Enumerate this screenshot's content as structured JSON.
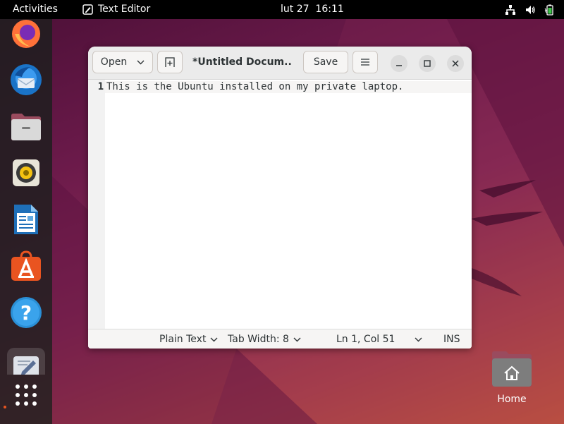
{
  "topbar": {
    "activities_label": "Activities",
    "app_menu_label": "Text Editor",
    "clock": "lut 27  16:11",
    "tray_icons": [
      "network-icon",
      "volume-icon",
      "battery-icon"
    ]
  },
  "dock": {
    "apps": [
      "firefox",
      "thunderbird",
      "files",
      "rhythmbox",
      "libreoffice-writer",
      "app-center",
      "help",
      "text-editor"
    ],
    "show_apps": "show-apps-grid-icon"
  },
  "window": {
    "open_label": "Open",
    "title": "*Untitled Docum...",
    "save_label": "Save",
    "lines": [
      {
        "number": "1",
        "text": "This is the Ubuntu installed on my private laptop."
      }
    ],
    "statusbar": {
      "language": "Plain Text",
      "tab_width": "Tab Width: 8",
      "position": "Ln 1, Col 51",
      "mode": "INS"
    }
  },
  "desktop": {
    "home_label": "Home"
  },
  "colors": {
    "accent": "#e95420",
    "topbar_bg": "#000000",
    "headerbar_bg": "#ebebeb"
  }
}
